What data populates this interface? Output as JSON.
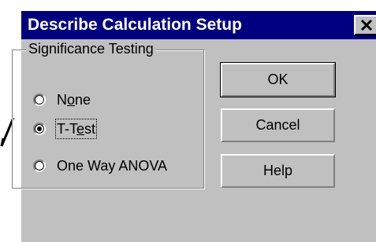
{
  "window": {
    "title": "Describe Calculation Setup",
    "close_glyph": "✕"
  },
  "group": {
    "label": "Significance Testing",
    "options": [
      {
        "pre": "N",
        "ul": "o",
        "post": "ne",
        "checked": false
      },
      {
        "pre": "T-T",
        "ul": "e",
        "post": "st",
        "checked": true
      },
      {
        "pre": "One Way ANOVA",
        "ul": "",
        "post": "",
        "checked": false
      }
    ]
  },
  "buttons": {
    "ok": "OK",
    "cancel": "Cancel",
    "help": "Help"
  },
  "colors": {
    "titlebar": "#000080",
    "face": "#c0c0c0"
  },
  "icons": {
    "close": "close-icon",
    "annotation": "check-tick-icon"
  }
}
